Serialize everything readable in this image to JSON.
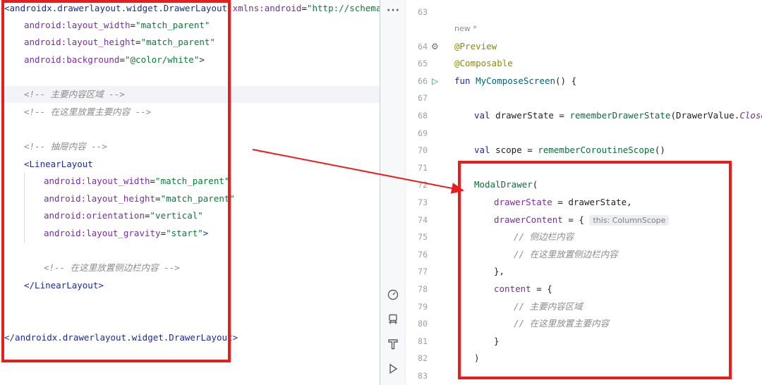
{
  "xml_editor": {
    "lines": [
      [
        {
          "t": "<androidx.drawerlayout.widget.DrawerLayout ",
          "c": "tag"
        },
        {
          "t": "xmlns:android",
          "c": "attr"
        },
        {
          "t": "=",
          "c": "plain"
        },
        {
          "t": "\"http://schemas.and",
          "c": "val"
        }
      ],
      [
        {
          "t": "android:layout_width",
          "c": "attr"
        },
        {
          "t": "=",
          "c": "plain"
        },
        {
          "t": "\"match_parent\"",
          "c": "val"
        }
      ],
      [
        {
          "t": "android:layout_height",
          "c": "attr"
        },
        {
          "t": "=",
          "c": "plain"
        },
        {
          "t": "\"match_parent\"",
          "c": "val"
        }
      ],
      [
        {
          "t": "android:background",
          "c": "attr"
        },
        {
          "t": "=",
          "c": "plain"
        },
        {
          "t": "\"@color/white\"",
          "c": "val"
        },
        {
          "t": ">",
          "c": "tag"
        }
      ],
      [],
      [
        {
          "t": "<!-- 主要内容区域 -->",
          "c": "cmt"
        }
      ],
      [
        {
          "t": "<!-- 在这里放置主要内容 -->",
          "c": "cmt"
        }
      ],
      [],
      [
        {
          "t": "<!-- 抽屉内容 -->",
          "c": "cmt"
        }
      ],
      [
        {
          "t": "<LinearLayout",
          "c": "tag"
        }
      ],
      [
        {
          "t": "android:layout_width",
          "c": "attr"
        },
        {
          "t": "=",
          "c": "plain"
        },
        {
          "t": "\"match_parent\"",
          "c": "val"
        }
      ],
      [
        {
          "t": "android:layout_height",
          "c": "attr"
        },
        {
          "t": "=",
          "c": "plain"
        },
        {
          "t": "\"match_parent\"",
          "c": "val"
        }
      ],
      [
        {
          "t": "android:orientation",
          "c": "attr"
        },
        {
          "t": "=",
          "c": "plain"
        },
        {
          "t": "\"vertical\"",
          "c": "val"
        }
      ],
      [
        {
          "t": "android:layout_gravity",
          "c": "attr"
        },
        {
          "t": "=",
          "c": "plain"
        },
        {
          "t": "\"start\"",
          "c": "val"
        },
        {
          "t": ">",
          "c": "tag"
        }
      ],
      [],
      [
        {
          "t": "<!-- 在这里放置侧边栏内容 -->",
          "c": "cmt"
        }
      ],
      [
        {
          "t": "</LinearLayout>",
          "c": "tag"
        }
      ],
      [],
      [],
      [
        {
          "t": "</androidx.drawerlayout.widget.DrawerLayout>",
          "c": "tag"
        }
      ]
    ]
  },
  "kotlin_editor": {
    "more_label": "···",
    "new_marker": "new *",
    "lines": [
      {
        "n": "63",
        "s": []
      },
      {
        "n": "64",
        "s": [
          {
            "t": "@Preview",
            "c": "ann"
          }
        ],
        "gear": true
      },
      {
        "n": "65",
        "s": [
          {
            "t": "@Composable",
            "c": "ann"
          }
        ]
      },
      {
        "n": "66",
        "s": [
          {
            "t": "fun ",
            "c": "kw"
          },
          {
            "t": "MyComposeScreen",
            "c": "fn"
          },
          {
            "t": "() {",
            "c": "plain"
          }
        ],
        "run": true
      },
      {
        "n": "67",
        "s": []
      },
      {
        "n": "68",
        "s": [
          {
            "t": "val ",
            "c": "kw"
          },
          {
            "t": "drawerState = ",
            "c": "plain"
          },
          {
            "t": "rememberDrawerState",
            "c": "call"
          },
          {
            "t": "(DrawerValue.",
            "c": "plain"
          },
          {
            "t": "Closed",
            "c": "italic"
          },
          {
            "t": ")",
            "c": "plain"
          }
        ]
      },
      {
        "n": "69",
        "s": []
      },
      {
        "n": "70",
        "s": [
          {
            "t": "val ",
            "c": "kw"
          },
          {
            "t": "scope = ",
            "c": "plain"
          },
          {
            "t": "rememberCoroutineScope",
            "c": "call"
          },
          {
            "t": "()",
            "c": "plain"
          }
        ]
      },
      {
        "n": "71",
        "s": []
      },
      {
        "n": "72",
        "s": [
          {
            "t": "ModalDrawer",
            "c": "call"
          },
          {
            "t": "(",
            "c": "plain"
          }
        ]
      },
      {
        "n": "73",
        "s": [
          {
            "t": "drawerState",
            "c": "prop"
          },
          {
            "t": " = drawerState,",
            "c": "plain"
          }
        ]
      },
      {
        "n": "74",
        "s": [
          {
            "t": "drawerContent",
            "c": "prop"
          },
          {
            "t": " = { ",
            "c": "plain"
          },
          {
            "t": "this: ColumnScope",
            "c": "hint"
          }
        ]
      },
      {
        "n": "75",
        "s": [
          {
            "t": "// 侧边栏内容",
            "c": "cmt"
          }
        ]
      },
      {
        "n": "76",
        "s": [
          {
            "t": "// 在这里放置侧边栏内容",
            "c": "cmt"
          }
        ]
      },
      {
        "n": "77",
        "s": [
          {
            "t": "},",
            "c": "plain"
          }
        ]
      },
      {
        "n": "78",
        "s": [
          {
            "t": "content",
            "c": "prop"
          },
          {
            "t": " = {",
            "c": "plain"
          }
        ]
      },
      {
        "n": "79",
        "s": [
          {
            "t": "// 主要内容区域",
            "c": "cmt"
          }
        ]
      },
      {
        "n": "80",
        "s": [
          {
            "t": "// 在这里放置主要内容",
            "c": "cmt"
          }
        ]
      },
      {
        "n": "81",
        "s": [
          {
            "t": "}",
            "c": "plain"
          }
        ]
      },
      {
        "n": "82",
        "s": [
          {
            "t": ")",
            "c": "plain"
          }
        ]
      },
      {
        "n": "83",
        "s": []
      }
    ]
  },
  "sidebar_icons": [
    "gauge-icon",
    "device-manager-icon",
    "hammer-icon",
    "run-icon"
  ],
  "colors": {
    "annotation_red": "#e61e1e",
    "editor_bg": "#ffffff",
    "sidebar_bg": "#f7f8fa"
  }
}
